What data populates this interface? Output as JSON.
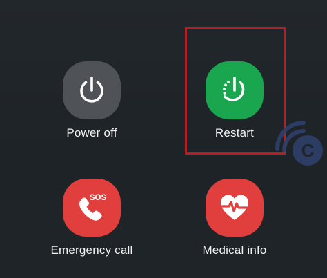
{
  "colors": {
    "background": "#1f2428",
    "power_off_tile": "#4f5256",
    "restart_tile": "#1aa54f",
    "emergency_tile": "#e13f3d",
    "medical_tile": "#e13f3d",
    "highlight_border": "#b51e22",
    "label_text": "#f2f2f2"
  },
  "options": [
    {
      "id": "power_off",
      "label": "Power off",
      "icon": "power-icon"
    },
    {
      "id": "restart",
      "label": "Restart",
      "icon": "restart-icon"
    },
    {
      "id": "emergency_call",
      "label": "Emergency call",
      "icon": "phone-sos-icon",
      "badge": "SOS"
    },
    {
      "id": "medical_info",
      "label": "Medical info",
      "icon": "heart-pulse-icon"
    }
  ],
  "watermark": {
    "letter": "C"
  }
}
